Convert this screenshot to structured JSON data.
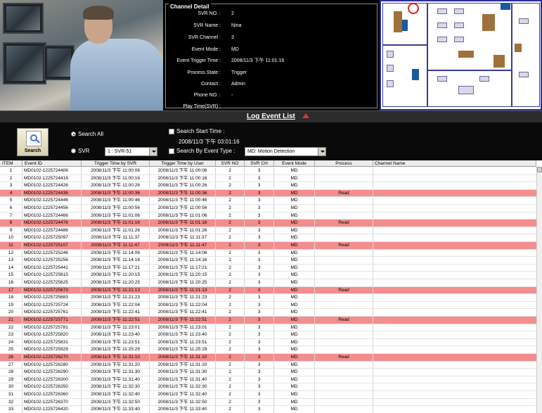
{
  "channel_detail": {
    "title": "Channel Detail",
    "fields": [
      {
        "label": "SVR NO. :",
        "value": "2"
      },
      {
        "label": "SVR Name :",
        "value": "Nina"
      },
      {
        "label": "SVR Channel :",
        "value": "3"
      },
      {
        "label": "Event Mode :",
        "value": "MD"
      },
      {
        "label": "Event Trigger Time :",
        "value": "2008/11/3 下午 11:01:16"
      },
      {
        "label": "Process State :",
        "value": "Trigger"
      },
      {
        "label": "Contact :",
        "value": "Admin"
      },
      {
        "label": "Phone NO. :",
        "value": "-"
      },
      {
        "label": "Play Time(SVR) :",
        "value": ""
      }
    ]
  },
  "log": {
    "title": "Log Event List"
  },
  "search": {
    "button_label": "Search",
    "search_all_label": "Search All",
    "svr_label": "SVR",
    "svr_select_value": "1 : SVR-51",
    "start_time_label": "Search Start Time :",
    "start_time_value": "2008/11/3 下午 03:01:16",
    "event_type_label": "Search By Event Type :",
    "event_type_value": "MD: Motion Detection"
  },
  "table": {
    "columns": [
      "ITEM",
      "Event ID",
      "Trigger Time by SVR",
      "Trigger Time by User",
      "SVR NO",
      "SVR CH",
      "Event Mode",
      "Process",
      "Channel Name"
    ],
    "highlight_color": "#f48d8d",
    "rows": [
      {
        "item": "1",
        "event_id": "MD0102-1225724406",
        "svr_time": "2008/11/3 下午 11:00:06",
        "user_time": "2008/11/3 下午 11:00:06",
        "svr_no": "2",
        "svr_ch": "3",
        "mode": "MD",
        "process": "",
        "channel": "",
        "hl": false
      },
      {
        "item": "2",
        "event_id": "MD0102-1225724416",
        "svr_time": "2008/11/3 下午 11:00:16",
        "user_time": "2008/11/3 下午 11:00:16",
        "svr_no": "2",
        "svr_ch": "3",
        "mode": "MD",
        "process": "",
        "channel": "",
        "hl": false
      },
      {
        "item": "3",
        "event_id": "MD0102-1225724426",
        "svr_time": "2008/11/3 下午 11:00:26",
        "user_time": "2008/11/3 下午 11:00:26",
        "svr_no": "2",
        "svr_ch": "3",
        "mode": "MD",
        "process": "",
        "channel": "",
        "hl": false
      },
      {
        "item": "4",
        "event_id": "MD0102-1225724436",
        "svr_time": "2008/11/3 下午 11:00:36",
        "user_time": "2008/11/3 下午 11:00:36",
        "svr_no": "2",
        "svr_ch": "3",
        "mode": "MD",
        "process": "Read",
        "channel": "",
        "hl": true
      },
      {
        "item": "5",
        "event_id": "MD0102-1225724446",
        "svr_time": "2008/11/3 下午 11:00:46",
        "user_time": "2008/11/3 下午 11:00:46",
        "svr_no": "2",
        "svr_ch": "3",
        "mode": "MD",
        "process": "",
        "channel": "",
        "hl": false
      },
      {
        "item": "6",
        "event_id": "MD0102-1225724456",
        "svr_time": "2008/11/3 下午 11:00:56",
        "user_time": "2008/11/3 下午 11:00:56",
        "svr_no": "2",
        "svr_ch": "3",
        "mode": "MD",
        "process": "",
        "channel": "",
        "hl": false
      },
      {
        "item": "7",
        "event_id": "MD0102-1225724466",
        "svr_time": "2008/11/3 下午 11:01:06",
        "user_time": "2008/11/3 下午 11:01:06",
        "svr_no": "2",
        "svr_ch": "3",
        "mode": "MD",
        "process": "",
        "channel": "",
        "hl": false
      },
      {
        "item": "8",
        "event_id": "MD0102-1225724476",
        "svr_time": "2008/11/3 下午 11:01:16",
        "user_time": "2008/11/3 下午 11:01:16",
        "svr_no": "2",
        "svr_ch": "3",
        "mode": "MD",
        "process": "Read",
        "channel": "",
        "hl": true
      },
      {
        "item": "9",
        "event_id": "MD0102-1225724486",
        "svr_time": "2008/11/3 下午 11:01:26",
        "user_time": "2008/11/3 下午 11:01:26",
        "svr_no": "2",
        "svr_ch": "3",
        "mode": "MD",
        "process": "",
        "channel": "",
        "hl": false
      },
      {
        "item": "10",
        "event_id": "MD0102-1225725097",
        "svr_time": "2008/11/3 下午 11:11:37",
        "user_time": "2008/11/3 下午 11:11:37",
        "svr_no": "2",
        "svr_ch": "3",
        "mode": "MD",
        "process": "",
        "channel": "",
        "hl": false
      },
      {
        "item": "11",
        "event_id": "MD0102-1225725107",
        "svr_time": "2008/11/3 下午 11:11:47",
        "user_time": "2008/11/3 下午 11:11:47",
        "svr_no": "2",
        "svr_ch": "3",
        "mode": "MD",
        "process": "Read",
        "channel": "",
        "hl": true
      },
      {
        "item": "12",
        "event_id": "MD0102-1225725246",
        "svr_time": "2008/11/3 下午 11:14:06",
        "user_time": "2008/11/3 下午 11:14:06",
        "svr_no": "2",
        "svr_ch": "3",
        "mode": "MD",
        "process": "",
        "channel": "",
        "hl": false
      },
      {
        "item": "13",
        "event_id": "MD0102-1225725256",
        "svr_time": "2008/11/3 下午 11:14:16",
        "user_time": "2008/11/3 下午 11:14:16",
        "svr_no": "2",
        "svr_ch": "3",
        "mode": "MD",
        "process": "",
        "channel": "",
        "hl": false
      },
      {
        "item": "14",
        "event_id": "MD0102-1225725441",
        "svr_time": "2008/11/3 下午 11:17:21",
        "user_time": "2008/11/3 下午 11:17:21",
        "svr_no": "2",
        "svr_ch": "3",
        "mode": "MD",
        "process": "",
        "channel": "",
        "hl": false
      },
      {
        "item": "15",
        "event_id": "MD0102-1225725615",
        "svr_time": "2008/11/3 下午 11:20:15",
        "user_time": "2008/11/3 下午 11:20:15",
        "svr_no": "2",
        "svr_ch": "3",
        "mode": "MD",
        "process": "",
        "channel": "",
        "hl": false
      },
      {
        "item": "16",
        "event_id": "MD0102-1225725625",
        "svr_time": "2008/11/3 下午 11:20:25",
        "user_time": "2008/11/3 下午 11:20:25",
        "svr_no": "2",
        "svr_ch": "3",
        "mode": "MD",
        "process": "",
        "channel": "",
        "hl": false
      },
      {
        "item": "17",
        "event_id": "MD0102-1225725673",
        "svr_time": "2008/11/3 下午 11:21:13",
        "user_time": "2008/11/3 下午 11:21:13",
        "svr_no": "2",
        "svr_ch": "3",
        "mode": "MD",
        "process": "Read",
        "channel": "",
        "hl": true
      },
      {
        "item": "18",
        "event_id": "MD0102-1225725683",
        "svr_time": "2008/11/3 下午 11:21:23",
        "user_time": "2008/11/3 下午 11:21:23",
        "svr_no": "2",
        "svr_ch": "3",
        "mode": "MD",
        "process": "",
        "channel": "",
        "hl": false
      },
      {
        "item": "19",
        "event_id": "MD0102-1225725724",
        "svr_time": "2008/11/3 下午 11:22:04",
        "user_time": "2008/11/3 下午 11:22:04",
        "svr_no": "2",
        "svr_ch": "3",
        "mode": "MD",
        "process": "",
        "channel": "",
        "hl": false
      },
      {
        "item": "20",
        "event_id": "MD0102-1225725761",
        "svr_time": "2008/11/3 下午 11:22:41",
        "user_time": "2008/11/3 下午 11:22:41",
        "svr_no": "2",
        "svr_ch": "3",
        "mode": "MD",
        "process": "",
        "channel": "",
        "hl": false
      },
      {
        "item": "21",
        "event_id": "MD0102-1225725771",
        "svr_time": "2008/11/3 下午 11:22:51",
        "user_time": "2008/11/3 下午 11:22:51",
        "svr_no": "2",
        "svr_ch": "3",
        "mode": "MD",
        "process": "Read",
        "channel": "",
        "hl": true
      },
      {
        "item": "22",
        "event_id": "MD0102-1225725781",
        "svr_time": "2008/11/3 下午 11:23:01",
        "user_time": "2008/11/3 下午 11:23:01",
        "svr_no": "2",
        "svr_ch": "3",
        "mode": "MD",
        "process": "",
        "channel": "",
        "hl": false
      },
      {
        "item": "23",
        "event_id": "MD0102-1225725820",
        "svr_time": "2008/11/3 下午 11:23:40",
        "user_time": "2008/11/3 下午 11:23:40",
        "svr_no": "2",
        "svr_ch": "3",
        "mode": "MD",
        "process": "",
        "channel": "",
        "hl": false
      },
      {
        "item": "24",
        "event_id": "MD0102-1225725831",
        "svr_time": "2008/11/3 下午 11:23:51",
        "user_time": "2008/11/3 下午 11:23:51",
        "svr_no": "2",
        "svr_ch": "3",
        "mode": "MD",
        "process": "",
        "channel": "",
        "hl": false
      },
      {
        "item": "25",
        "event_id": "MD0102-1225725929",
        "svr_time": "2008/11/3 下午 11:25:29",
        "user_time": "2008/11/3 下午 11:25:29",
        "svr_no": "2",
        "svr_ch": "3",
        "mode": "MD",
        "process": "",
        "channel": "",
        "hl": false
      },
      {
        "item": "26",
        "event_id": "MD0102-1225726270",
        "svr_time": "2008/11/3 下午 11:31:10",
        "user_time": "2008/11/3 下午 11:31:10",
        "svr_no": "2",
        "svr_ch": "3",
        "mode": "MD",
        "process": "Read",
        "channel": "",
        "hl": true
      },
      {
        "item": "27",
        "event_id": "MD0102-1225726280",
        "svr_time": "2008/11/3 下午 11:31:20",
        "user_time": "2008/11/3 下午 11:31:20",
        "svr_no": "2",
        "svr_ch": "3",
        "mode": "MD",
        "process": "",
        "channel": "",
        "hl": false
      },
      {
        "item": "28",
        "event_id": "MD0102-1225726290",
        "svr_time": "2008/11/3 下午 11:31:30",
        "user_time": "2008/11/3 下午 11:31:30",
        "svr_no": "2",
        "svr_ch": "3",
        "mode": "MD",
        "process": "",
        "channel": "",
        "hl": false
      },
      {
        "item": "29",
        "event_id": "MD0102-1225726300",
        "svr_time": "2008/11/3 下午 11:31:40",
        "user_time": "2008/11/3 下午 11:31:40",
        "svr_no": "2",
        "svr_ch": "3",
        "mode": "MD",
        "process": "",
        "channel": "",
        "hl": false
      },
      {
        "item": "30",
        "event_id": "MD0102-1225726350",
        "svr_time": "2008/11/3 下午 11:32:30",
        "user_time": "2008/11/3 下午 11:32:30",
        "svr_no": "2",
        "svr_ch": "3",
        "mode": "MD",
        "process": "",
        "channel": "",
        "hl": false
      },
      {
        "item": "31",
        "event_id": "MD0102-1225726360",
        "svr_time": "2008/11/3 下午 11:32:40",
        "user_time": "2008/11/3 下午 11:32:40",
        "svr_no": "2",
        "svr_ch": "3",
        "mode": "MD",
        "process": "",
        "channel": "",
        "hl": false
      },
      {
        "item": "32",
        "event_id": "MD0102-1225726370",
        "svr_time": "2008/11/3 下午 11:32:50",
        "user_time": "2008/11/3 下午 11:32:50",
        "svr_no": "2",
        "svr_ch": "3",
        "mode": "MD",
        "process": "",
        "channel": "",
        "hl": false
      },
      {
        "item": "33",
        "event_id": "MD0102-1225726420",
        "svr_time": "2008/11/3 下午 11:33:40",
        "user_time": "2008/11/3 下午 11:33:40",
        "svr_no": "2",
        "svr_ch": "3",
        "mode": "MD",
        "process": "",
        "channel": "",
        "hl": false
      }
    ]
  }
}
